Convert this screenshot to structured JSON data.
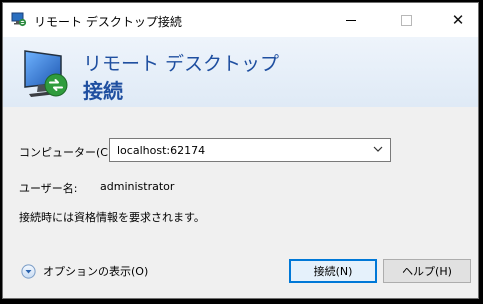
{
  "window": {
    "title": "リモート デスクトップ接続",
    "close_glyph": "✕"
  },
  "banner": {
    "line1": "リモート デスクトップ",
    "line2": "接続"
  },
  "form": {
    "computer_label": "コンピューター(C):",
    "computer_value": "localhost:62174",
    "user_label": "ユーザー名:",
    "user_value": "administrator",
    "credential_note": "接続時には資格情報を要求されます。"
  },
  "options": {
    "label": "オプションの表示(O)"
  },
  "buttons": {
    "connect": "接続(N)",
    "help": "ヘルプ(H)"
  },
  "colors": {
    "banner_text": "#1f4fa0",
    "default_button_border": "#0078d7"
  }
}
